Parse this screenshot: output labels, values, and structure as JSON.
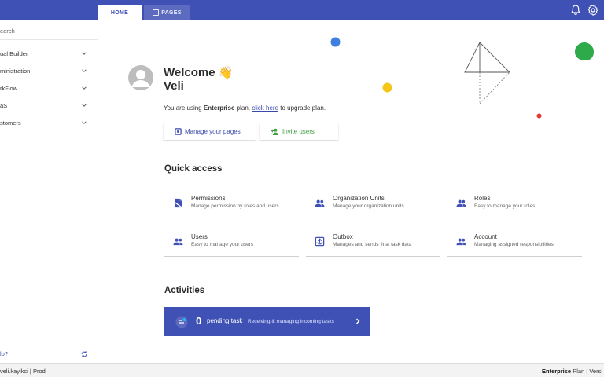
{
  "header": {
    "tabs": [
      {
        "label": "HOME",
        "active": true
      },
      {
        "label": "PAGES",
        "active": false
      }
    ],
    "icons": [
      "bell-icon",
      "gear-icon"
    ],
    "color": "#3f51b5"
  },
  "sidebar": {
    "search_text": "earch",
    "items": [
      {
        "label": "ual Builder"
      },
      {
        "label": "ministration"
      },
      {
        "label": "rkFlow"
      },
      {
        "label": "aS"
      },
      {
        "label": "stomers"
      }
    ],
    "help_label": "lp?"
  },
  "welcome": {
    "title": "Welcome 👋",
    "name": "Veli",
    "plan_prefix": "You are using ",
    "plan_name": "Enterprise",
    "plan_mid": " plan, ",
    "plan_link": "click here",
    "plan_suffix": " to upgrade plan."
  },
  "actions": {
    "manage_label": "Manage your pages",
    "invite_label": "Invite users"
  },
  "quick_access": {
    "title": "Quick access",
    "cards": [
      {
        "title": "Permissions",
        "desc": "Manage permission by roles and users",
        "icon": "lock-doc-icon"
      },
      {
        "title": "Organization Units",
        "desc": "Manage your organization units",
        "icon": "group-icon"
      },
      {
        "title": "Roles",
        "desc": "Easy to manage your roles",
        "icon": "group-icon"
      },
      {
        "title": "Users",
        "desc": "Easy to manage your users",
        "icon": "group-icon"
      },
      {
        "title": "Outbox",
        "desc": "Manages and sends final task data",
        "icon": "outbox-icon"
      },
      {
        "title": "Account",
        "desc": "Managing assigned responsibilities",
        "icon": "group-icon"
      }
    ]
  },
  "activities": {
    "title": "Activities",
    "pending_count": "0",
    "pending_label": "pending task",
    "pending_desc": "Receiving & managing incoming tasks"
  },
  "footer": {
    "left": "veli.kayikci | Prod",
    "plan_name": "Enterprise",
    "plan_suffix": " Plan | Versi"
  },
  "colors": {
    "primary": "#3f51b5",
    "blue_dot": "#3f7fe0",
    "yellow_dot": "#f5c518",
    "green_blob": "#2eaa4a",
    "red_dot": "#e53935",
    "invite_green": "#43a047"
  }
}
